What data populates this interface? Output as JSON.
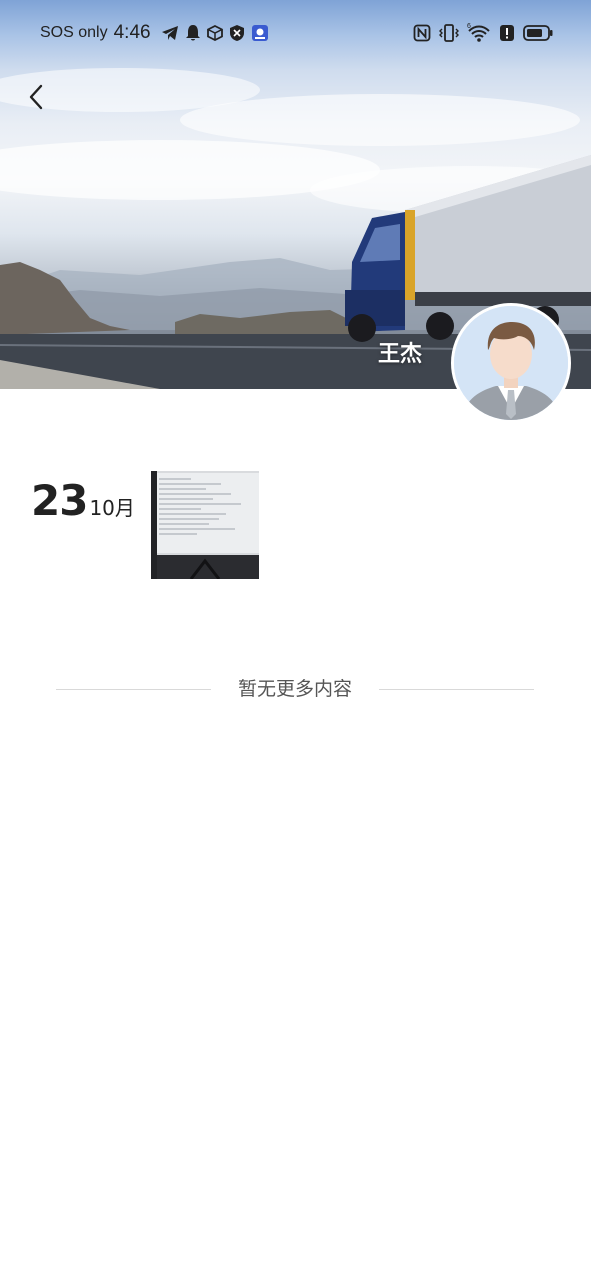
{
  "status_bar": {
    "carrier": "SOS only",
    "time": "4:46",
    "left_icons": [
      "telegram-icon",
      "bell-icon",
      "box-icon",
      "shield-icon",
      "app-icon"
    ],
    "right_icons": [
      "nfc-icon",
      "vibrate-icon",
      "wifi-icon",
      "alert-icon",
      "battery-icon"
    ]
  },
  "header": {
    "cover": "highway-truck-winter-photo",
    "back_icon": "chevron-left-icon"
  },
  "profile": {
    "name": "王杰",
    "avatar": "businessman-avatar"
  },
  "posts": [
    {
      "day": "23",
      "month": "10月",
      "thumbnail": "computer-monitor-photo"
    }
  ],
  "footer": {
    "end_text": "暂无更多内容"
  },
  "colors": {
    "background": "#ffffff",
    "divider": "#d9d9d9",
    "muted_text": "#555555",
    "avatar_bg": "#d4e4f6"
  }
}
